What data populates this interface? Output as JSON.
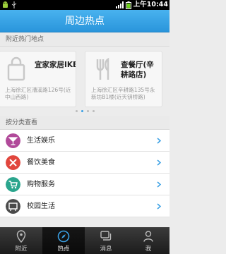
{
  "status_bar": {
    "time": "上午10:44"
  },
  "header": {
    "title": "周边热点"
  },
  "nearby": {
    "section_title": "附近热门地点",
    "cards": [
      {
        "name": "宜家家居IKEA(徐汇...",
        "address": "上海徐汇区漕溪路126号(近中山西路)"
      },
      {
        "name": "查餐厅(辛耕路店)",
        "address": "上海徐汇区辛耕路135号永新坊B1楼(近天钥桥路)"
      }
    ],
    "page_count": 4,
    "active_page": 2
  },
  "categories": {
    "section_title": "按分类查看",
    "items": [
      {
        "label": "生活娱乐",
        "icon": "cocktail-icon",
        "color": "#b14a9a"
      },
      {
        "label": "餐饮美食",
        "icon": "fork-knife-icon",
        "color": "#e1463d"
      },
      {
        "label": "购物服务",
        "icon": "shopping-cart-icon",
        "color": "#2ba58d"
      },
      {
        "label": "校园生活",
        "icon": "blackboard-icon",
        "color": "#4a4a4a"
      }
    ]
  },
  "tabs": [
    {
      "label": "附近",
      "icon": "location-pin-icon"
    },
    {
      "label": "热点",
      "icon": "compass-icon",
      "active": true
    },
    {
      "label": "消息",
      "icon": "message-icon"
    },
    {
      "label": "我",
      "icon": "person-icon"
    }
  ],
  "colors": {
    "accent": "#3ba0e4",
    "tabbar": "#2a2a2a"
  }
}
